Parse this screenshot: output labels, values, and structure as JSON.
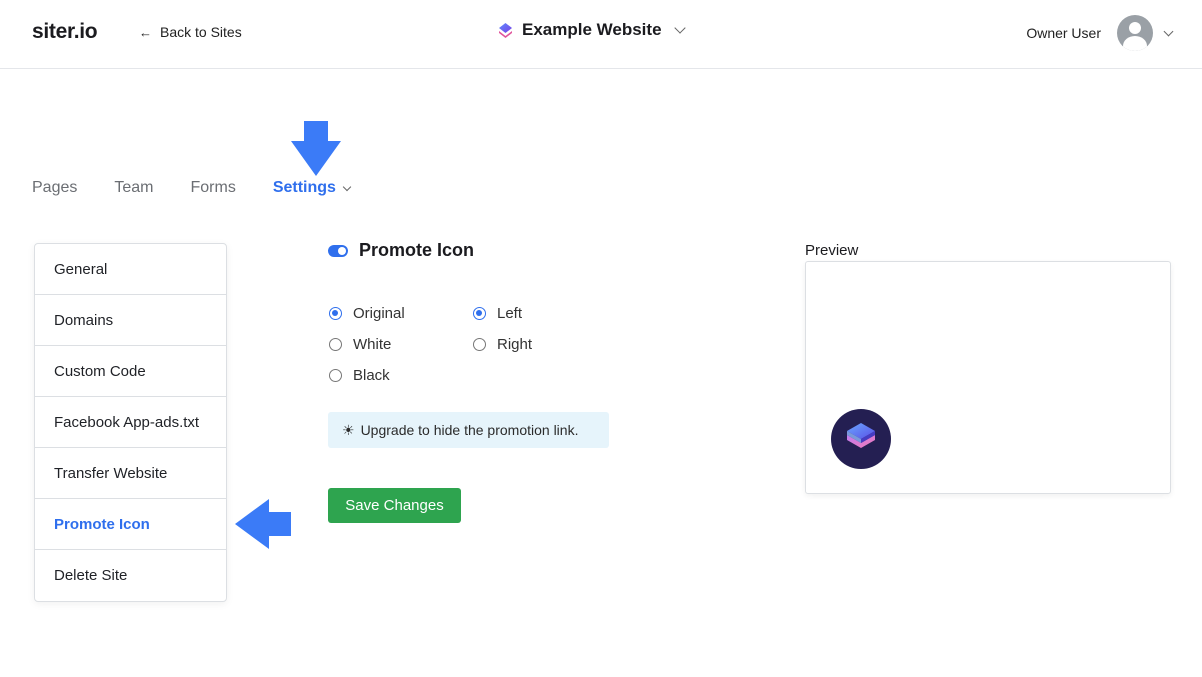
{
  "header": {
    "logo": "siter.io",
    "back_label": "Back to Sites",
    "site_name": "Example Website",
    "user_name": "Owner User"
  },
  "tabs": [
    {
      "label": "Pages"
    },
    {
      "label": "Team"
    },
    {
      "label": "Forms"
    },
    {
      "label": "Settings",
      "active": true
    }
  ],
  "settings_menu": [
    {
      "label": "General"
    },
    {
      "label": "Domains"
    },
    {
      "label": "Custom Code"
    },
    {
      "label": "Facebook App-ads.txt"
    },
    {
      "label": "Transfer Website"
    },
    {
      "label": "Promote Icon",
      "active": true
    },
    {
      "label": "Delete Site"
    }
  ],
  "promote": {
    "toggle_label": "Promote Icon",
    "toggle_on": true,
    "color_options": [
      {
        "label": "Original",
        "checked": true
      },
      {
        "label": "White",
        "checked": false
      },
      {
        "label": "Black",
        "checked": false
      }
    ],
    "position_options": [
      {
        "label": "Left",
        "checked": true
      },
      {
        "label": "Right",
        "checked": false
      }
    ],
    "upgrade_note": "Upgrade to hide the promotion link.",
    "upgrade_icon": "☀",
    "save_label": "Save Changes"
  },
  "preview": {
    "title": "Preview"
  },
  "colors": {
    "accent": "#2f6fed",
    "save_button": "#2ea44f",
    "note_background": "#e6f4fb",
    "promo_icon_background": "#241f52",
    "annotation_arrow": "#3b7bf7"
  }
}
